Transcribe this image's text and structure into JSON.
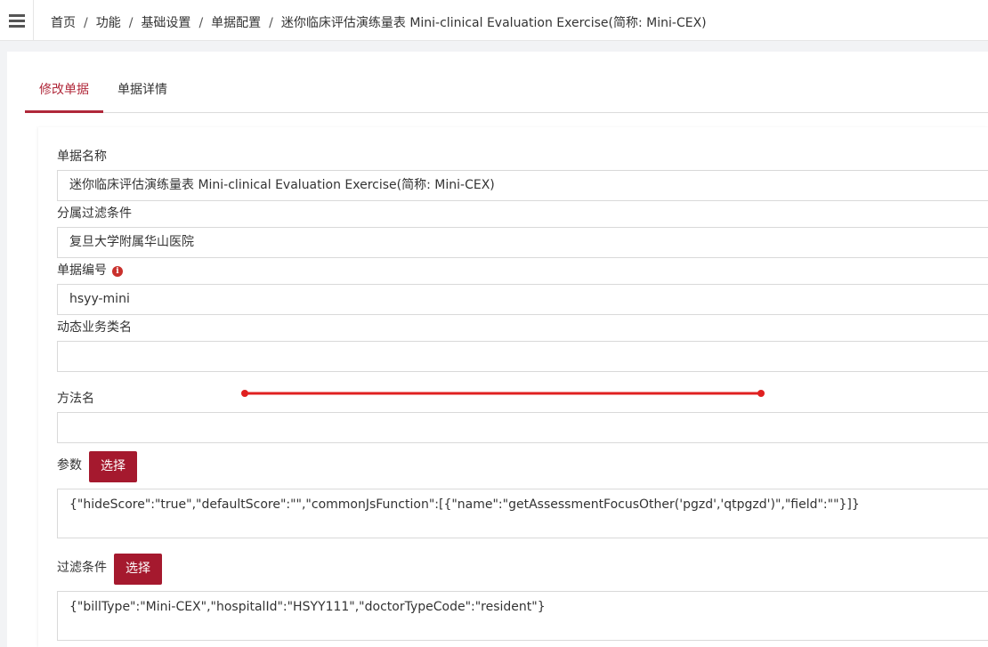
{
  "header": {
    "breadcrumb": [
      "首页",
      "功能",
      "基础设置",
      "单据配置",
      "迷你临床评估演练量表 Mini-clinical Evaluation Exercise(简称: Mini-CEX)"
    ],
    "separator": "/"
  },
  "tabs": [
    {
      "label": "修改单据",
      "active": true
    },
    {
      "label": "单据详情",
      "active": false
    }
  ],
  "form": {
    "bill_name": {
      "label": "单据名称",
      "value": "迷你临床评估演练量表 Mini-clinical Evaluation Exercise(简称: Mini-CEX)"
    },
    "filter_belong": {
      "label": "分属过滤条件",
      "value": "复旦大学附属华山医院"
    },
    "bill_code": {
      "label": "单据编号",
      "value": "hsyy-mini",
      "info_icon": "info-icon"
    },
    "dynamic_class": {
      "label": "动态业务类名",
      "value": ""
    },
    "method_name": {
      "label": "方法名",
      "value": ""
    },
    "params": {
      "label": "参数",
      "button": "选择",
      "value": "{\"hideScore\":\"true\",\"defaultScore\":\"\",\"commonJsFunction\":[{\"name\":\"getAssessmentFocusOther('pgzd','qtpgzd')\",\"field\":\"\"}]}"
    },
    "filter_cond": {
      "label": "过滤条件",
      "button": "选择",
      "value": "{\"billType\":\"Mini-CEX\",\"hospitalId\":\"HSYY111\",\"doctorTypeCode\":\"resident\"}"
    }
  },
  "colors": {
    "accent": "#b0283a",
    "button": "#a5192e",
    "annotation": "#e02020"
  }
}
